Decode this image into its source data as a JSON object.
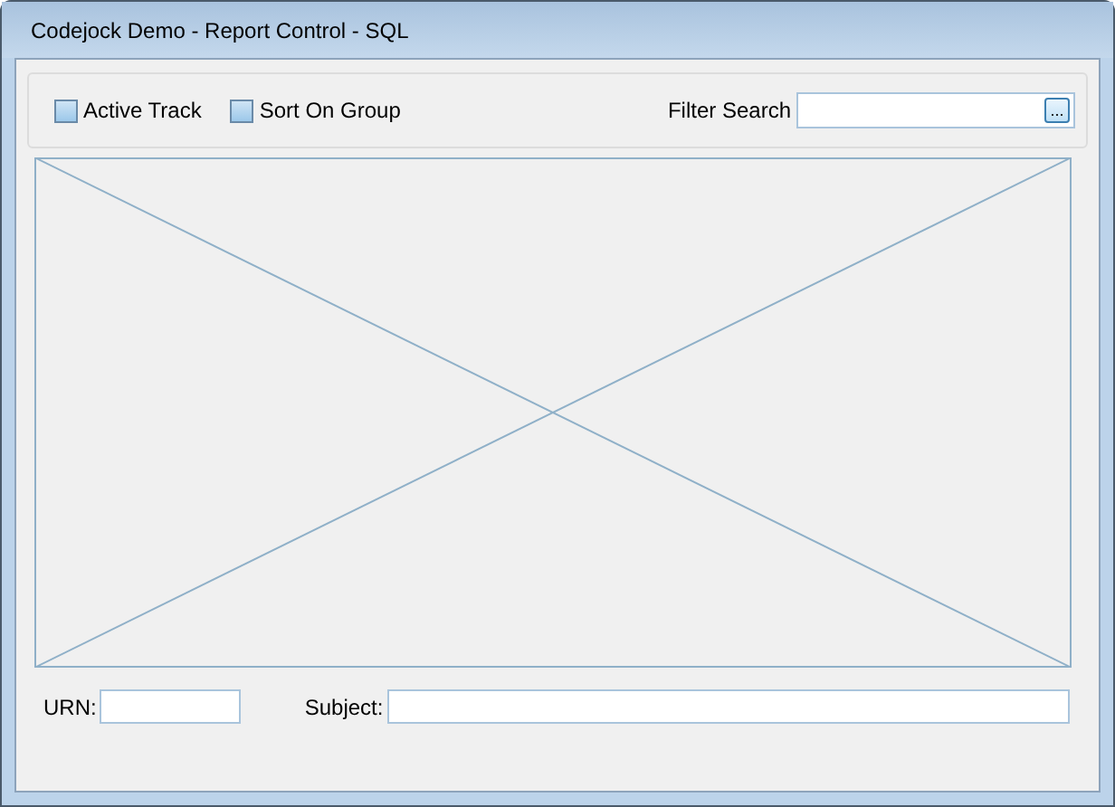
{
  "window": {
    "title": "Codejock Demo - Report Control - SQL"
  },
  "options": [
    {
      "label": "Active Track",
      "checked": false
    },
    {
      "label": "Sort On Group",
      "checked": false
    }
  ],
  "filter": {
    "label": "Filter Search",
    "button": "..."
  },
  "fields": [
    {
      "label": "URN:"
    },
    {
      "label": "Subject:"
    }
  ]
}
